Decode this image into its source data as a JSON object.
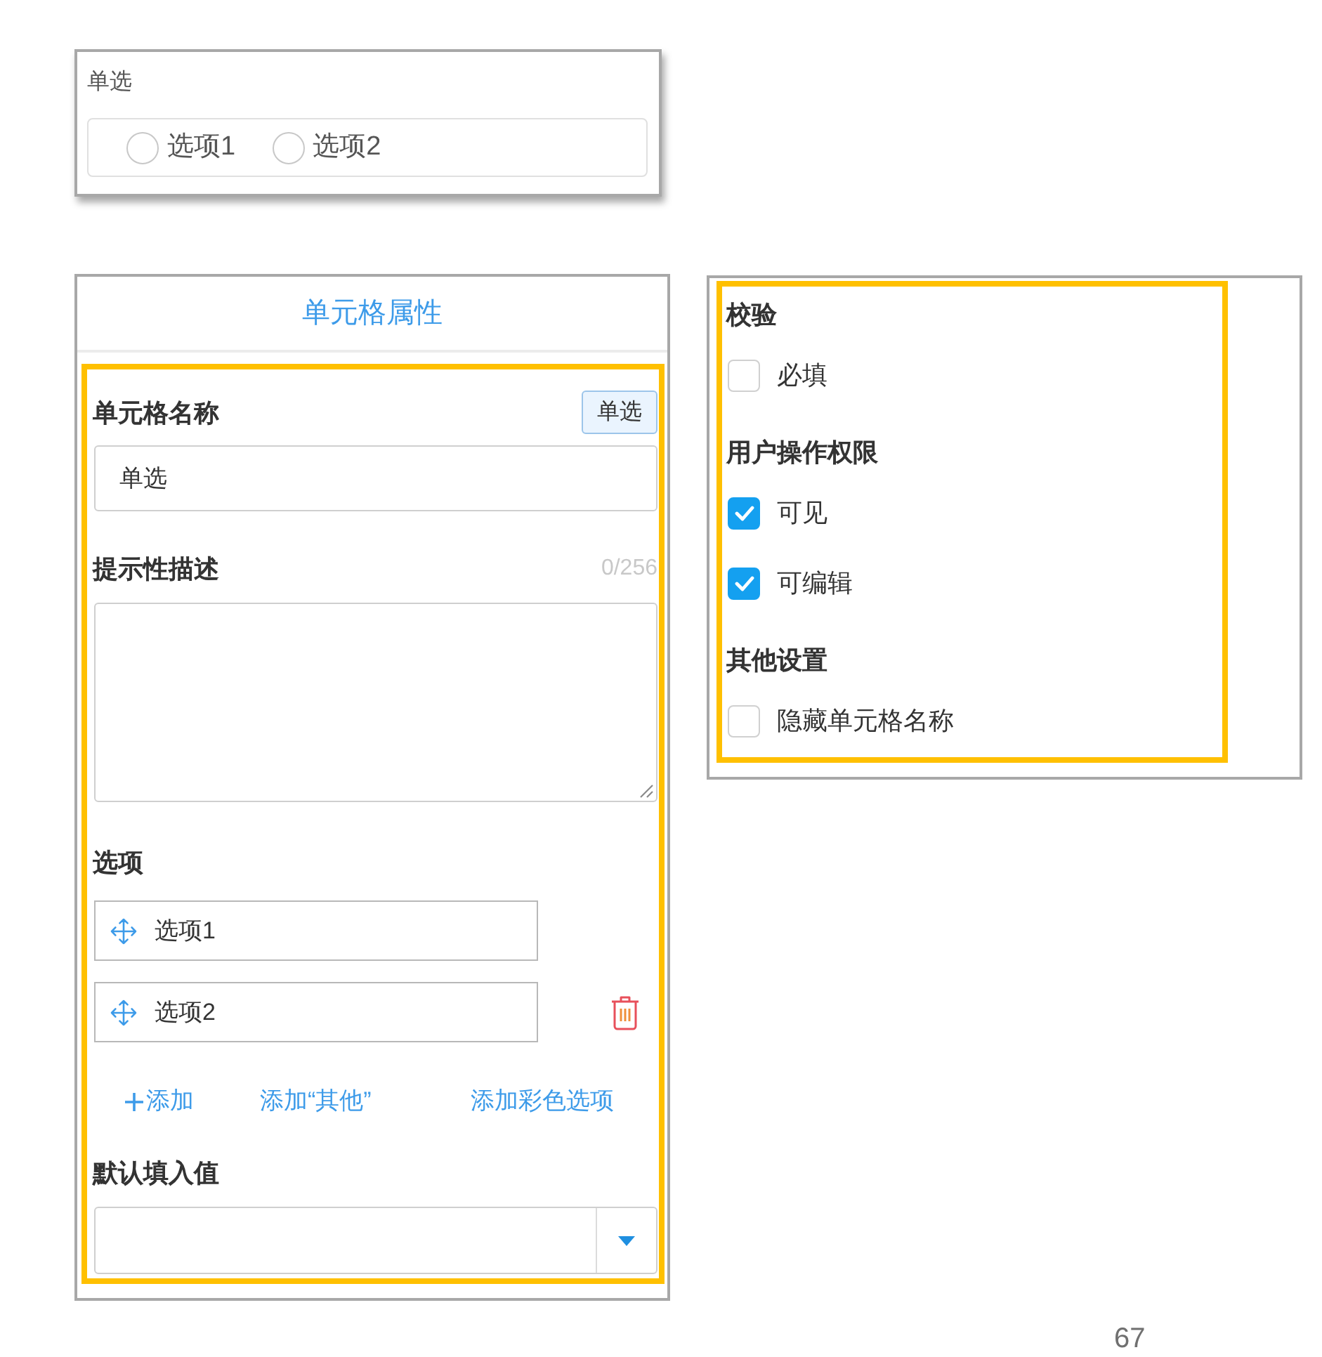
{
  "preview": {
    "label": "单选",
    "options": [
      {
        "label": "选项1",
        "selected": false
      },
      {
        "label": "选项2",
        "selected": false
      }
    ]
  },
  "properties_panel": {
    "title": "单元格属性",
    "name_field": {
      "label": "单元格名称",
      "type_button": "单选",
      "value": "单选"
    },
    "description_field": {
      "label": "提示性描述",
      "counter": "0/256"
    },
    "options_section": {
      "label": "选项",
      "options": [
        {
          "label": "选项1",
          "deletable": false
        },
        {
          "label": "选项2",
          "deletable": true
        }
      ],
      "actions": [
        {
          "label": "添加",
          "kind": "add"
        },
        {
          "label": "添加“其他”",
          "kind": "add_other"
        },
        {
          "label": "添加彩色选项",
          "kind": "add_color"
        }
      ]
    },
    "default_value": {
      "label": "默认填入值"
    }
  },
  "settings_panel": {
    "sections": [
      {
        "title": "校验",
        "items": [
          {
            "label": "必填",
            "checked": false
          }
        ]
      },
      {
        "title": "用户操作权限",
        "items": [
          {
            "label": "可见",
            "checked": true
          },
          {
            "label": "可编辑",
            "checked": true
          }
        ]
      },
      {
        "title": "其他设置",
        "items": [
          {
            "label": "隐藏单元格名称",
            "checked": false
          }
        ]
      }
    ]
  },
  "page_number": "67"
}
